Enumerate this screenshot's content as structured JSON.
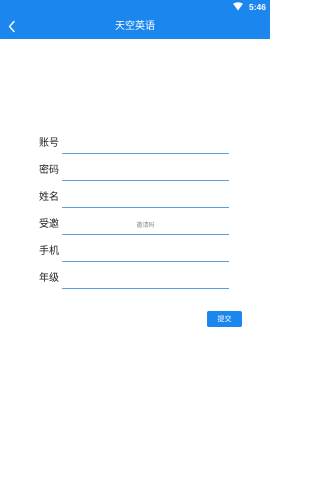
{
  "status_bar": {
    "time": "5:46",
    "wifi_icon": "wifi-icon"
  },
  "app_bar": {
    "title": "天空英语",
    "back_icon": "back-arrow-icon"
  },
  "form": {
    "fields": [
      {
        "label": "账号",
        "value": "",
        "placeholder": ""
      },
      {
        "label": "密码",
        "value": "",
        "placeholder": ""
      },
      {
        "label": "姓名",
        "value": "",
        "placeholder": ""
      },
      {
        "label": "受邀",
        "value": "",
        "placeholder": "邀请码"
      },
      {
        "label": "手机",
        "value": "",
        "placeholder": ""
      },
      {
        "label": "年级",
        "value": "",
        "placeholder": ""
      }
    ],
    "submit_label": "提交"
  },
  "colors": {
    "primary": "#1a86ee",
    "underline": "#5c9ee0",
    "background": "#ffffff"
  }
}
